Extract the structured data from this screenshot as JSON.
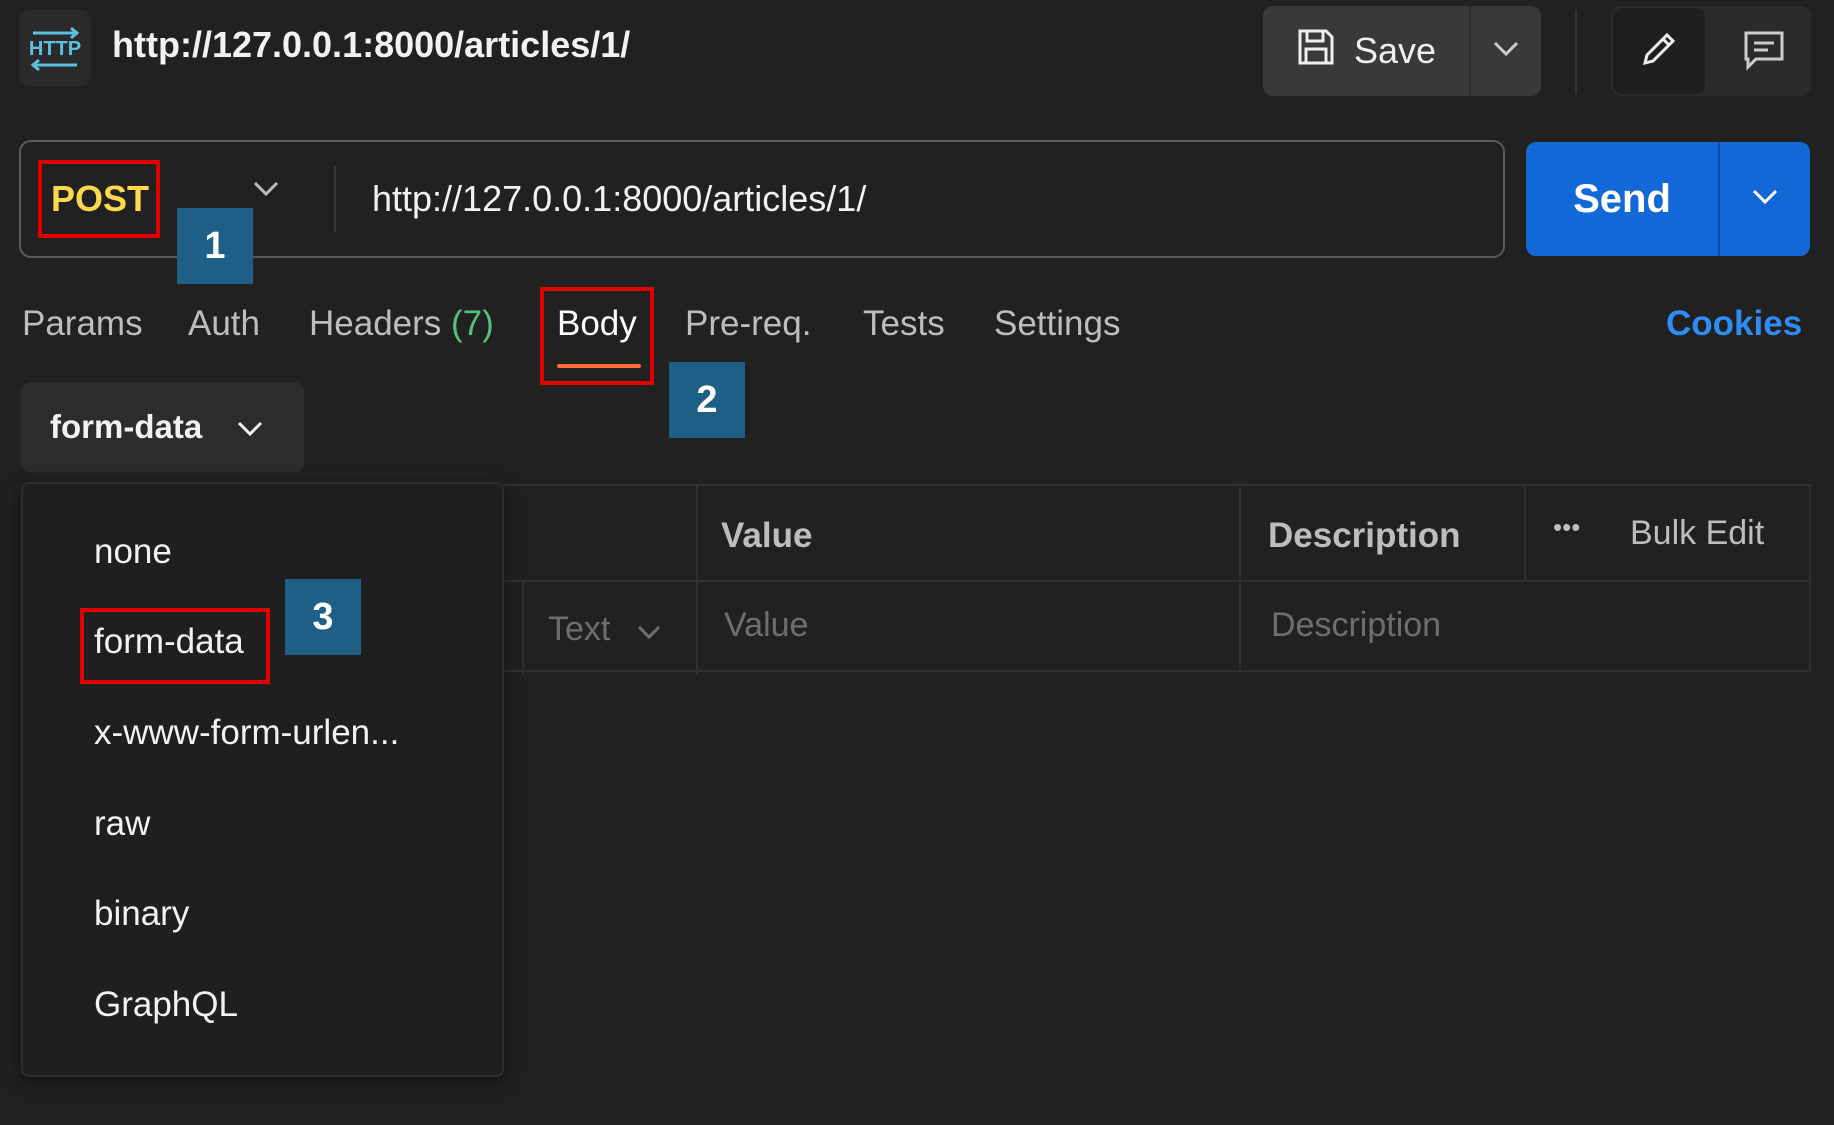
{
  "header": {
    "icon_text": "HTTP",
    "title": "http://127.0.0.1:8000/articles/1/",
    "save_label": "Save"
  },
  "request": {
    "method": "POST",
    "url": "http://127.0.0.1:8000/articles/1/",
    "send_label": "Send"
  },
  "tabs": {
    "params": "Params",
    "auth": "Auth",
    "headers": "Headers",
    "headers_count": "(7)",
    "body": "Body",
    "prereq": "Pre-req.",
    "tests": "Tests",
    "settings": "Settings",
    "cookies": "Cookies"
  },
  "body_type": {
    "selected": "form-data",
    "options": [
      "none",
      "form-data",
      "x-www-form-urlen...",
      "raw",
      "binary",
      "GraphQL"
    ]
  },
  "table": {
    "headers": {
      "value": "Value",
      "description": "Description",
      "more": "•••",
      "bulk_edit": "Bulk Edit"
    },
    "row": {
      "type": "Text",
      "value_placeholder": "Value",
      "description_placeholder": "Description"
    }
  },
  "callouts": [
    "1",
    "2",
    "3"
  ],
  "colors": {
    "background": "#212121",
    "method": "#ffd84d",
    "send": "#1268d6",
    "cookies": "#2f8cf5",
    "headers_count": "#52c47a",
    "active_tab_underline": "#ff6c37",
    "highlight_box": "#e00000",
    "callout": "#1d5f86"
  },
  "icons": [
    "http-icon",
    "save-icon",
    "chevron-down-icon",
    "pencil-icon",
    "comment-icon"
  ]
}
